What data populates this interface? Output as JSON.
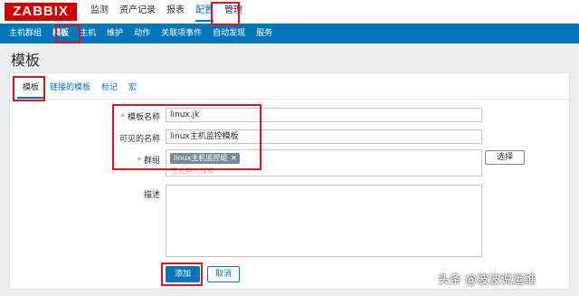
{
  "brand": {
    "logo_text": "ZABBIX",
    "logo_color": "#d40000"
  },
  "top_menu": {
    "items": [
      {
        "label": "监测"
      },
      {
        "label": "资产记录"
      },
      {
        "label": "报表"
      },
      {
        "label": "配置",
        "active": true
      },
      {
        "label": "管理"
      }
    ]
  },
  "sub_menu": {
    "items": [
      {
        "label": "主机群组"
      },
      {
        "label": "模板",
        "active": true
      },
      {
        "label": "主机"
      },
      {
        "label": "维护"
      },
      {
        "label": "动作"
      },
      {
        "label": "关联项事件"
      },
      {
        "label": "自动发现"
      },
      {
        "label": "服务"
      }
    ]
  },
  "page": {
    "title": "模板"
  },
  "tabs": {
    "items": [
      {
        "label": "模板",
        "active": true
      },
      {
        "label": "链接的模板"
      },
      {
        "label": "标记"
      },
      {
        "label": "宏"
      }
    ]
  },
  "form": {
    "template_name": {
      "label": "模板名称",
      "required_mark": "*",
      "value": "linux.jk"
    },
    "visible_name": {
      "label": "可见的名称",
      "value": "linux主机监控模板"
    },
    "groups": {
      "label": "群组",
      "required_mark": "*",
      "chip": "linux主机监控组",
      "chip_remove": "×",
      "placeholder": "在此输入搜索",
      "select_button": "选择"
    },
    "description": {
      "label": "描述",
      "value": ""
    },
    "add_button": "添加",
    "cancel_button": "取消"
  },
  "watermark": "头条 @波波说运维",
  "colors": {
    "accent": "#0275b8",
    "annotation": "#e0141c",
    "required": "#e45959"
  }
}
